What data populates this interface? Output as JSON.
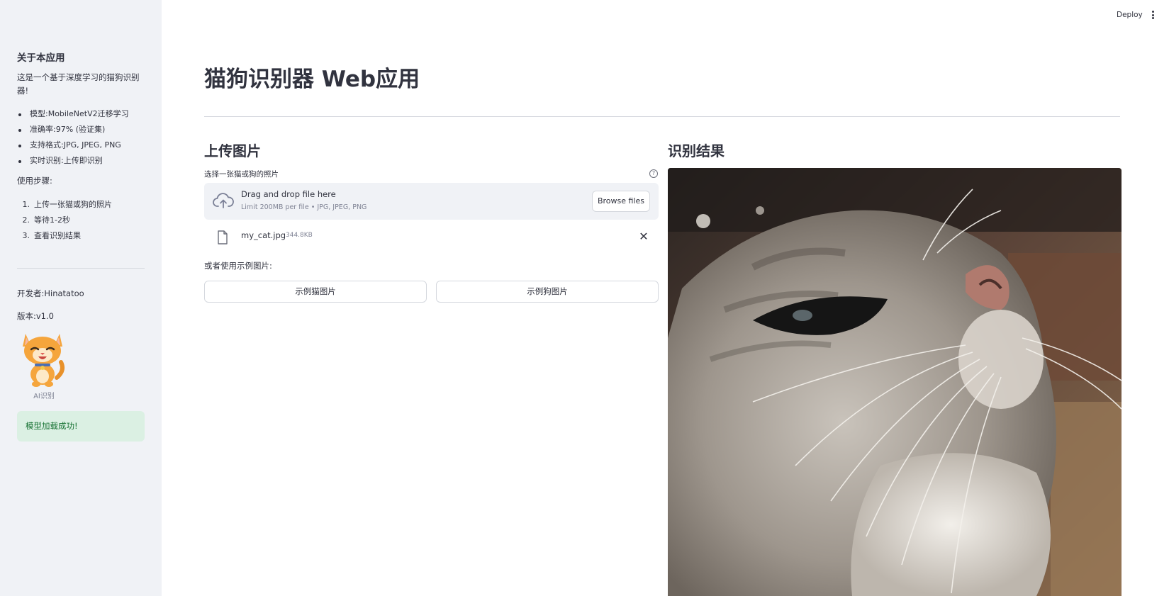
{
  "header": {
    "deploy_label": "Deploy",
    "menu_icon": "more-vertical-icon"
  },
  "sidebar": {
    "heading": "关于本应用",
    "intro": "这是一个基于深度学习的猫狗识别器!",
    "features": [
      "模型:MobileNetV2迁移学习",
      "准确率:97% (验证集)",
      "支持格式:JPG, JPEG, PNG",
      "实时识别:上传即识别"
    ],
    "steps_label": "使用步骤:",
    "steps": [
      {
        "num": "1.",
        "text": "上传一张猫或狗的照片"
      },
      {
        "num": "2.",
        "text": "等待1-2秒"
      },
      {
        "num": "3.",
        "text": "查看识别结果"
      }
    ],
    "developer": "开发者:Hinatatoo",
    "version": "版本:v1.0",
    "logo_icon": "cartoon-cat-logo",
    "logo_caption": "AI识别",
    "success_message": "模型加载成功!"
  },
  "main": {
    "title": "猫狗识别器 Web应用",
    "upload": {
      "heading": "上传图片",
      "label": "选择一张猫或狗的照片",
      "help_icon": "help-circle-icon",
      "dropzone_title": "Drag and drop file here",
      "dropzone_subtitle": "Limit 200MB per file • JPG, JPEG, PNG",
      "browse_label": "Browse files",
      "file_name": "my_cat.jpg",
      "file_size": "344.8KB"
    },
    "examples": {
      "label": "或者使用示例图片:",
      "cat_button": "示例猫图片",
      "dog_button": "示例狗图片"
    },
    "result": {
      "heading": "识别结果",
      "image": "cat-photo"
    }
  },
  "colors": {
    "sidebar_bg": "#f0f2f6",
    "text": "#31333f",
    "success_bg": "#dbf0e3",
    "success_text": "#177233"
  }
}
